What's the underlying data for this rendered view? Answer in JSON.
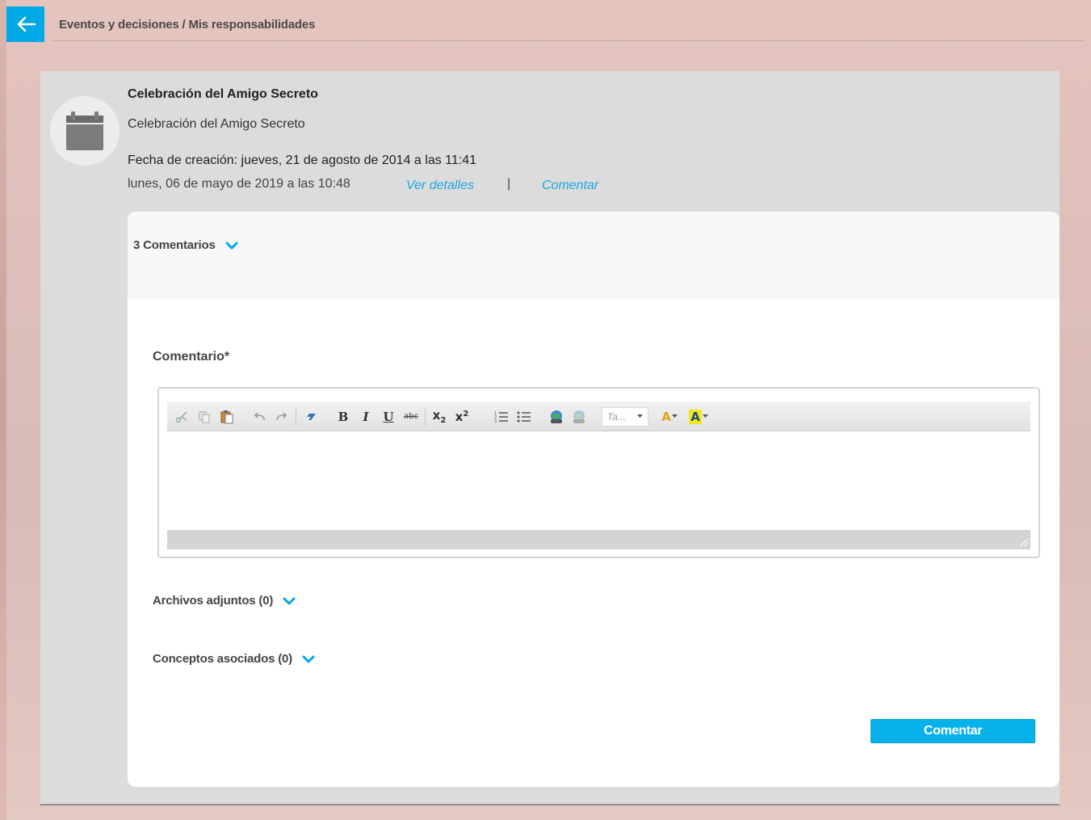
{
  "header": {
    "breadcrumb": "Eventos y decisiones / Mis responsabilidades"
  },
  "item": {
    "title": "Celebración del Amigo Secreto",
    "description": "Celebración del Amigo Secreto",
    "created": "Fecha de creación: jueves, 21 de agosto de 2014 a las 11:41",
    "date": "lunes, 06 de mayo de 2019 a las 10:48",
    "details_link": "Ver detalles",
    "separator": "|",
    "comment_link": "Comentar"
  },
  "comments": {
    "toggle_label": "3 Comentarios"
  },
  "form": {
    "comment_label": "Comentario*",
    "editor": {
      "font_combo": "Ta...",
      "buttons": {
        "bold": "B",
        "italic": "I",
        "underline": "U",
        "strike": "abc",
        "subscript": "x",
        "subscript_index": "2",
        "superscript": "x",
        "superscript_index": "2",
        "font_color": "A",
        "bg_color": "A"
      }
    },
    "attachments_label": "Archivos adjuntos (0)",
    "concepts_label": "Conceptos asociados (0)",
    "submit_label": "Comentar"
  },
  "colors": {
    "accent": "#00a9e6",
    "link": "#1ba8df",
    "panel": "#dcdcdc"
  },
  "icons": {
    "back": "arrow-left-icon",
    "item": "calendar-icon",
    "expand": "chevron-down-icon"
  }
}
